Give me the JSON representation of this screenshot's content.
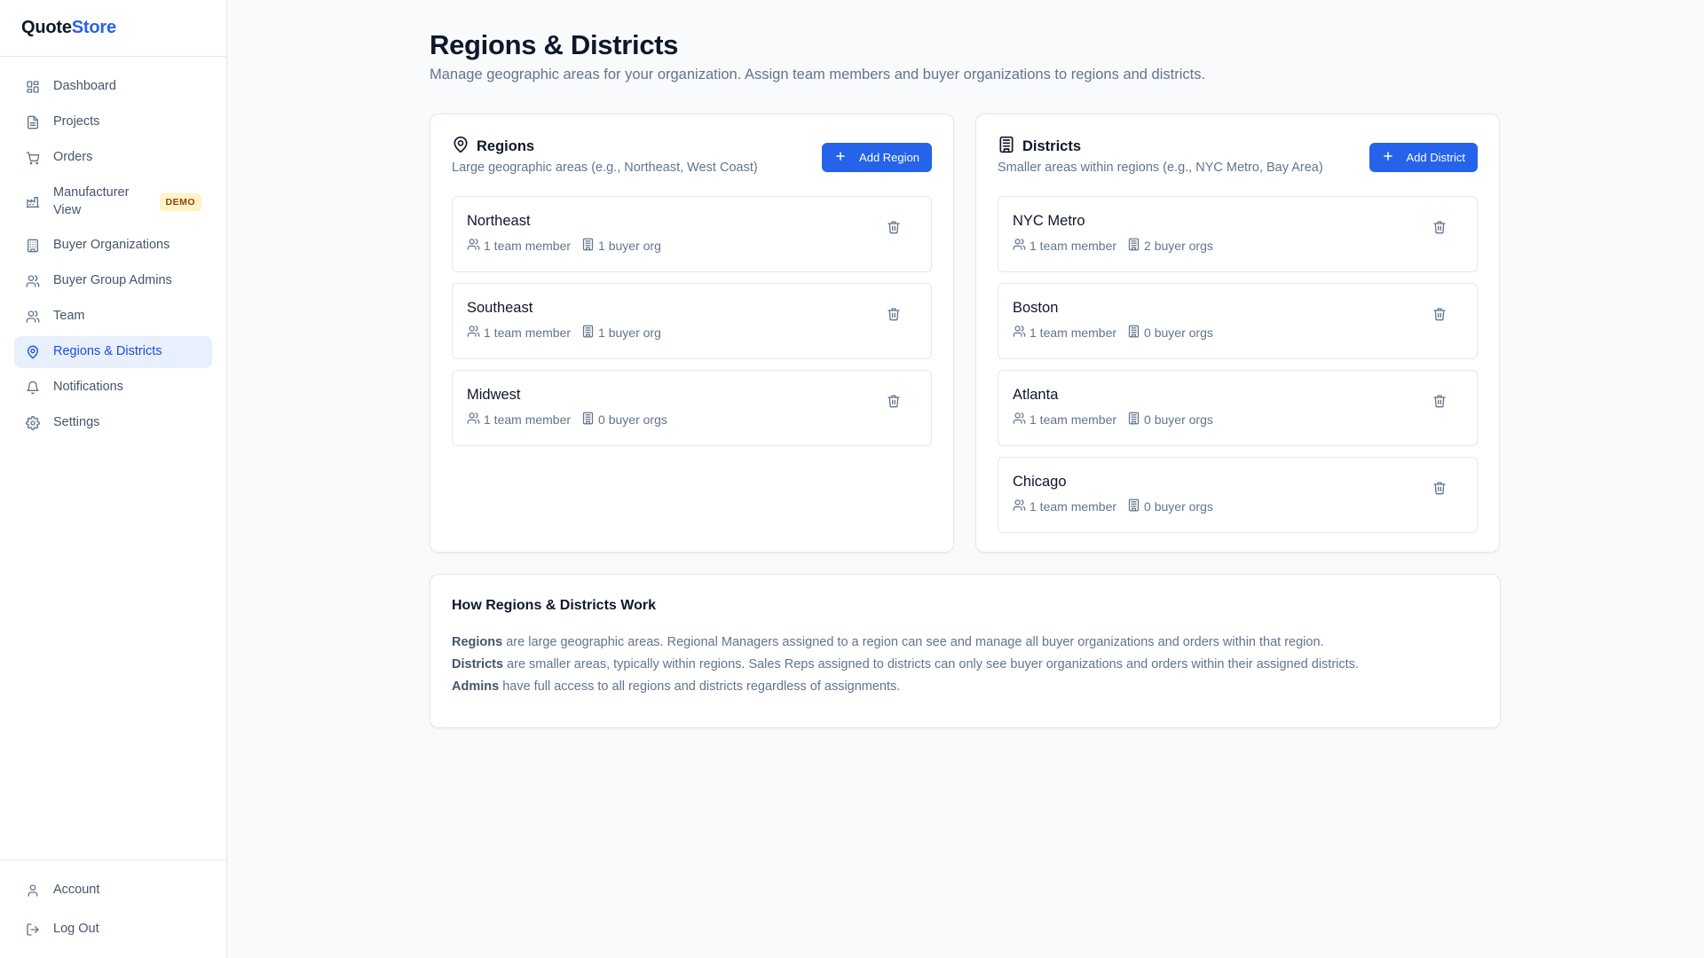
{
  "brand": {
    "part1": "Quote",
    "part2": "Store"
  },
  "sidebar": {
    "items": [
      {
        "label": "Dashboard",
        "icon": "dashboard-icon"
      },
      {
        "label": "Projects",
        "icon": "file-icon"
      },
      {
        "label": "Orders",
        "icon": "cart-icon"
      },
      {
        "label": "Manufacturer View",
        "icon": "factory-icon",
        "badge": "DEMO"
      },
      {
        "label": "Buyer Organizations",
        "icon": "building-icon"
      },
      {
        "label": "Buyer Group Admins",
        "icon": "users-icon"
      },
      {
        "label": "Team",
        "icon": "users-icon"
      },
      {
        "label": "Regions & Districts",
        "icon": "map-pin-icon",
        "active": true
      },
      {
        "label": "Notifications",
        "icon": "bell-icon"
      },
      {
        "label": "Settings",
        "icon": "gear-icon"
      }
    ],
    "bottom": [
      {
        "label": "Account",
        "icon": "user-icon"
      },
      {
        "label": "Log Out",
        "icon": "logout-icon"
      }
    ]
  },
  "page": {
    "title": "Regions & Districts",
    "subtitle": "Manage geographic areas for your organization. Assign team members and buyer organizations to regions and districts."
  },
  "regions": {
    "title": "Regions",
    "subtitle": "Large geographic areas (e.g., Northeast, West Coast)",
    "add_label": "Add Region",
    "items": [
      {
        "name": "Northeast",
        "members": "1 team member",
        "orgs": "1 buyer org"
      },
      {
        "name": "Southeast",
        "members": "1 team member",
        "orgs": "1 buyer org"
      },
      {
        "name": "Midwest",
        "members": "1 team member",
        "orgs": "0 buyer orgs"
      }
    ]
  },
  "districts": {
    "title": "Districts",
    "subtitle": "Smaller areas within regions (e.g., NYC Metro, Bay Area)",
    "add_label": "Add District",
    "items": [
      {
        "name": "NYC Metro",
        "members": "1 team member",
        "orgs": "2 buyer orgs"
      },
      {
        "name": "Boston",
        "members": "1 team member",
        "orgs": "0 buyer orgs"
      },
      {
        "name": "Atlanta",
        "members": "1 team member",
        "orgs": "0 buyer orgs"
      },
      {
        "name": "Chicago",
        "members": "1 team member",
        "orgs": "0 buyer orgs"
      }
    ]
  },
  "info": {
    "title": "How Regions & Districts Work",
    "lines": [
      {
        "term": "Regions",
        "text": " are large geographic areas. Regional Managers assigned to a region can see and manage all buyer organizations and orders within that region."
      },
      {
        "term": "Districts",
        "text": " are smaller areas, typically within regions. Sales Reps assigned to districts can only see buyer organizations and orders within their assigned districts."
      },
      {
        "term": "Admins",
        "text": " have full access to all regions and districts regardless of assignments."
      }
    ]
  },
  "colors": {
    "accent": "#2563eb",
    "active_bg": "#e8effd",
    "badge_bg": "#fef3c7",
    "badge_text": "#92400e"
  }
}
